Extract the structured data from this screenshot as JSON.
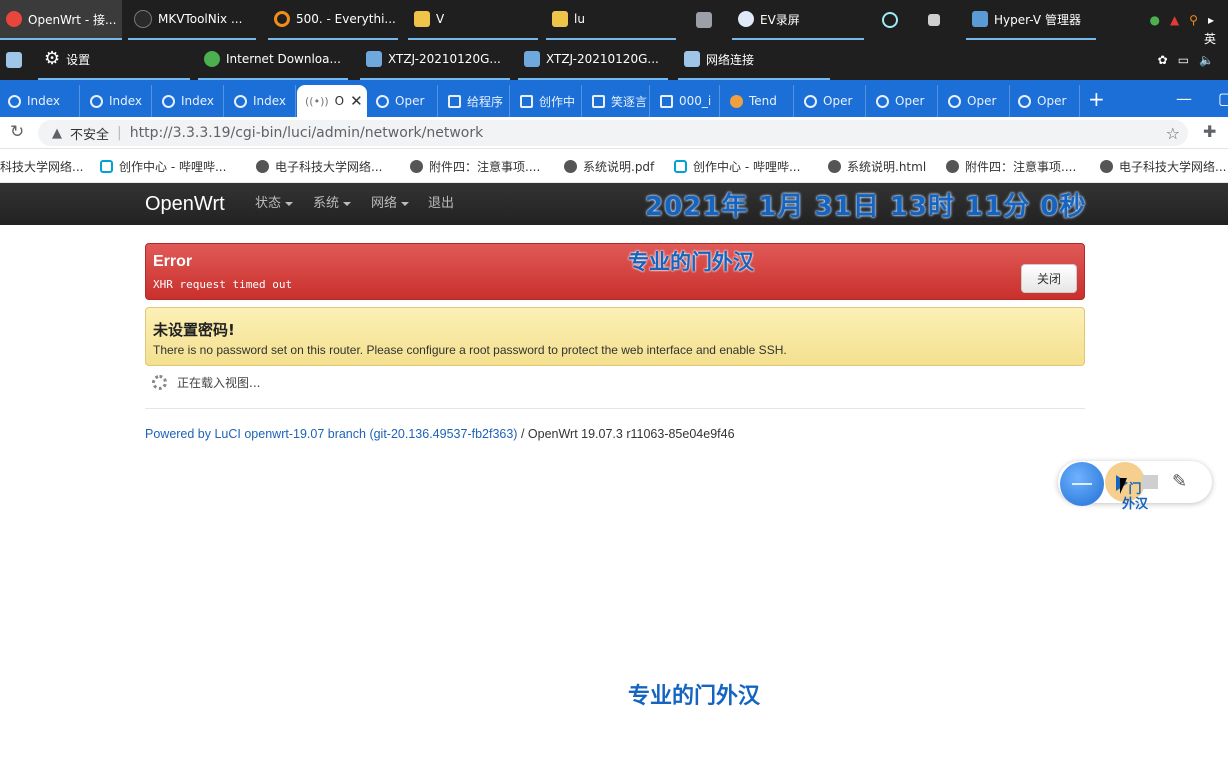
{
  "taskbar": {
    "row1": [
      {
        "label": "OpenWrt - 接...",
        "icon": "chrome-icon",
        "color": "#e8453c",
        "active": true
      },
      {
        "label": "MKVToolNix ...",
        "icon": "mkvtoolnix-icon",
        "color": "#2a2a2a"
      },
      {
        "label": "500. - Everythi...",
        "icon": "everything-search-icon",
        "color": "#f28c1b"
      },
      {
        "label": "V",
        "icon": "folder-icon",
        "color": "#f0c34b"
      },
      {
        "label": "lu",
        "icon": "folder-icon",
        "color": "#f0c34b"
      },
      {
        "label": "",
        "icon": "network-icon",
        "color": "#9aa0a6"
      },
      {
        "label": "EV录屏",
        "icon": "ev-recorder-icon",
        "color": "#dfe9f7"
      },
      {
        "label": "",
        "icon": "electron-icon",
        "color": "#9feaf9"
      },
      {
        "label": "",
        "icon": "explorer-icon",
        "color": "#cfcfcf"
      },
      {
        "label": "Hyper-V 管理器",
        "icon": "hyperv-icon",
        "color": "#5a9bd5"
      }
    ],
    "row2": [
      {
        "label": "设置",
        "icon": "gear-icon",
        "color": "#ffffff"
      },
      {
        "label": "Internet Downloa...",
        "icon": "idm-icon",
        "color": "#4caf50"
      },
      {
        "label": "XTZJ-20210120G...",
        "icon": "remote-desktop-icon",
        "color": "#6fa8dc"
      },
      {
        "label": "XTZJ-20210120G...",
        "icon": "remote-desktop-icon",
        "color": "#6fa8dc"
      },
      {
        "label": "网络连接",
        "icon": "network-connections-icon",
        "color": "#9fc5e8"
      }
    ],
    "ime": "英"
  },
  "browser": {
    "tabs": [
      {
        "label": "Index"
      },
      {
        "label": "Index"
      },
      {
        "label": "Index"
      },
      {
        "label": "Index"
      },
      {
        "label": "O",
        "active": true
      },
      {
        "label": "Oper"
      },
      {
        "label": "给程序"
      },
      {
        "label": "创作中"
      },
      {
        "label": "笑逐言"
      },
      {
        "label": "000_i"
      },
      {
        "label": "Tend"
      },
      {
        "label": "Oper"
      },
      {
        "label": "Oper"
      },
      {
        "label": "Oper"
      },
      {
        "label": "Oper"
      }
    ],
    "new_tab": "+",
    "security_label": "不安全",
    "url": "http://3.3.3.19/cgi-bin/luci/admin/network/network",
    "bookmarks": [
      {
        "label": "科技大学网络...",
        "icon": "globe-icon"
      },
      {
        "label": "创作中心 - 哔哩哔...",
        "icon": "bilibili-icon"
      },
      {
        "label": "电子科技大学网络...",
        "icon": "globe-icon"
      },
      {
        "label": "附件四：注意事项....",
        "icon": "globe-icon"
      },
      {
        "label": "系统说明.pdf",
        "icon": "globe-icon"
      },
      {
        "label": "创作中心 - 哔哩哔...",
        "icon": "bilibili-icon"
      },
      {
        "label": "系统说明.html",
        "icon": "globe-icon"
      },
      {
        "label": "附件四：注意事项....",
        "icon": "globe-icon"
      },
      {
        "label": "电子科技大学网络...",
        "icon": "globe-icon"
      }
    ]
  },
  "navbar": {
    "brand": "OpenWrt",
    "items": [
      "状态",
      "系统",
      "网络",
      "退出"
    ],
    "overlay_datetime": "2021年 1月 31日 13时 11分 0秒"
  },
  "error_alert": {
    "title": "Error",
    "message": "XHR request timed out",
    "close_label": "关闭"
  },
  "watermark_text": "专业的门外汉",
  "warning_alert": {
    "title": "未设置密码!",
    "message": "There is no password set on this router. Please configure a root password to protect the web interface and enable SSH."
  },
  "loading_text": "正在载入视图...",
  "footer": {
    "link_text": "Powered by LuCI openwrt-19.07 branch (git-20.136.49537-fb2f363)",
    "separator": " / ",
    "version": "OpenWrt 19.07.3 r11063-85e04e9f46"
  },
  "recorder_widget": {
    "label_line1": "门",
    "label_line2": "外汉"
  },
  "colors": {
    "tab_strip": "#1b6fd6",
    "navbar": "#222222",
    "error": "#c9302c",
    "warning": "#f3e08f",
    "link": "#1e63b6",
    "watermark": "#1565c0"
  }
}
